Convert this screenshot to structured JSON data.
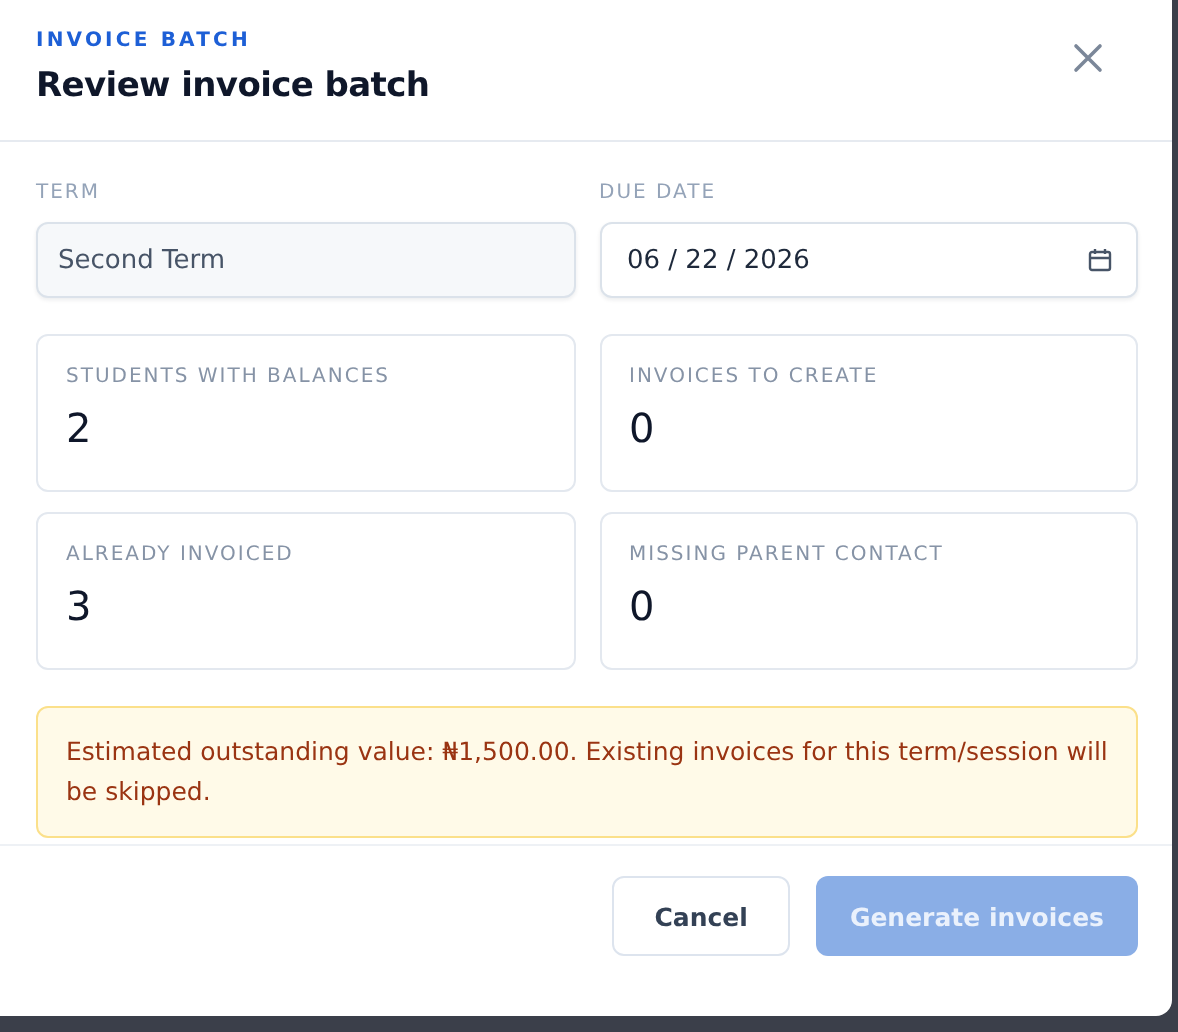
{
  "dialog": {
    "eyebrow": "INVOICE BATCH",
    "title": "Review invoice batch"
  },
  "fields": [
    {
      "kind": "select",
      "label": "TERM",
      "value": "Second Term",
      "disabled": true
    },
    {
      "kind": "date",
      "label": "DUE DATE",
      "value": "06 / 22 / 2026",
      "disabled": false
    }
  ],
  "stats": [
    {
      "label": "STUDENTS WITH BALANCES",
      "value": "2"
    },
    {
      "label": "INVOICES TO CREATE",
      "value": "0"
    },
    {
      "label": "ALREADY INVOICED",
      "value": "3"
    },
    {
      "label": "MISSING PARENT CONTACT",
      "value": "0"
    }
  ],
  "notice": "Estimated outstanding value: ₦1,500.00. Existing invoices for this term/session will be skipped.",
  "buttons": [
    {
      "kind": "secondary",
      "label": "Cancel",
      "disabled": false
    },
    {
      "kind": "primary",
      "label": "Generate invoices",
      "disabled": true
    }
  ]
}
